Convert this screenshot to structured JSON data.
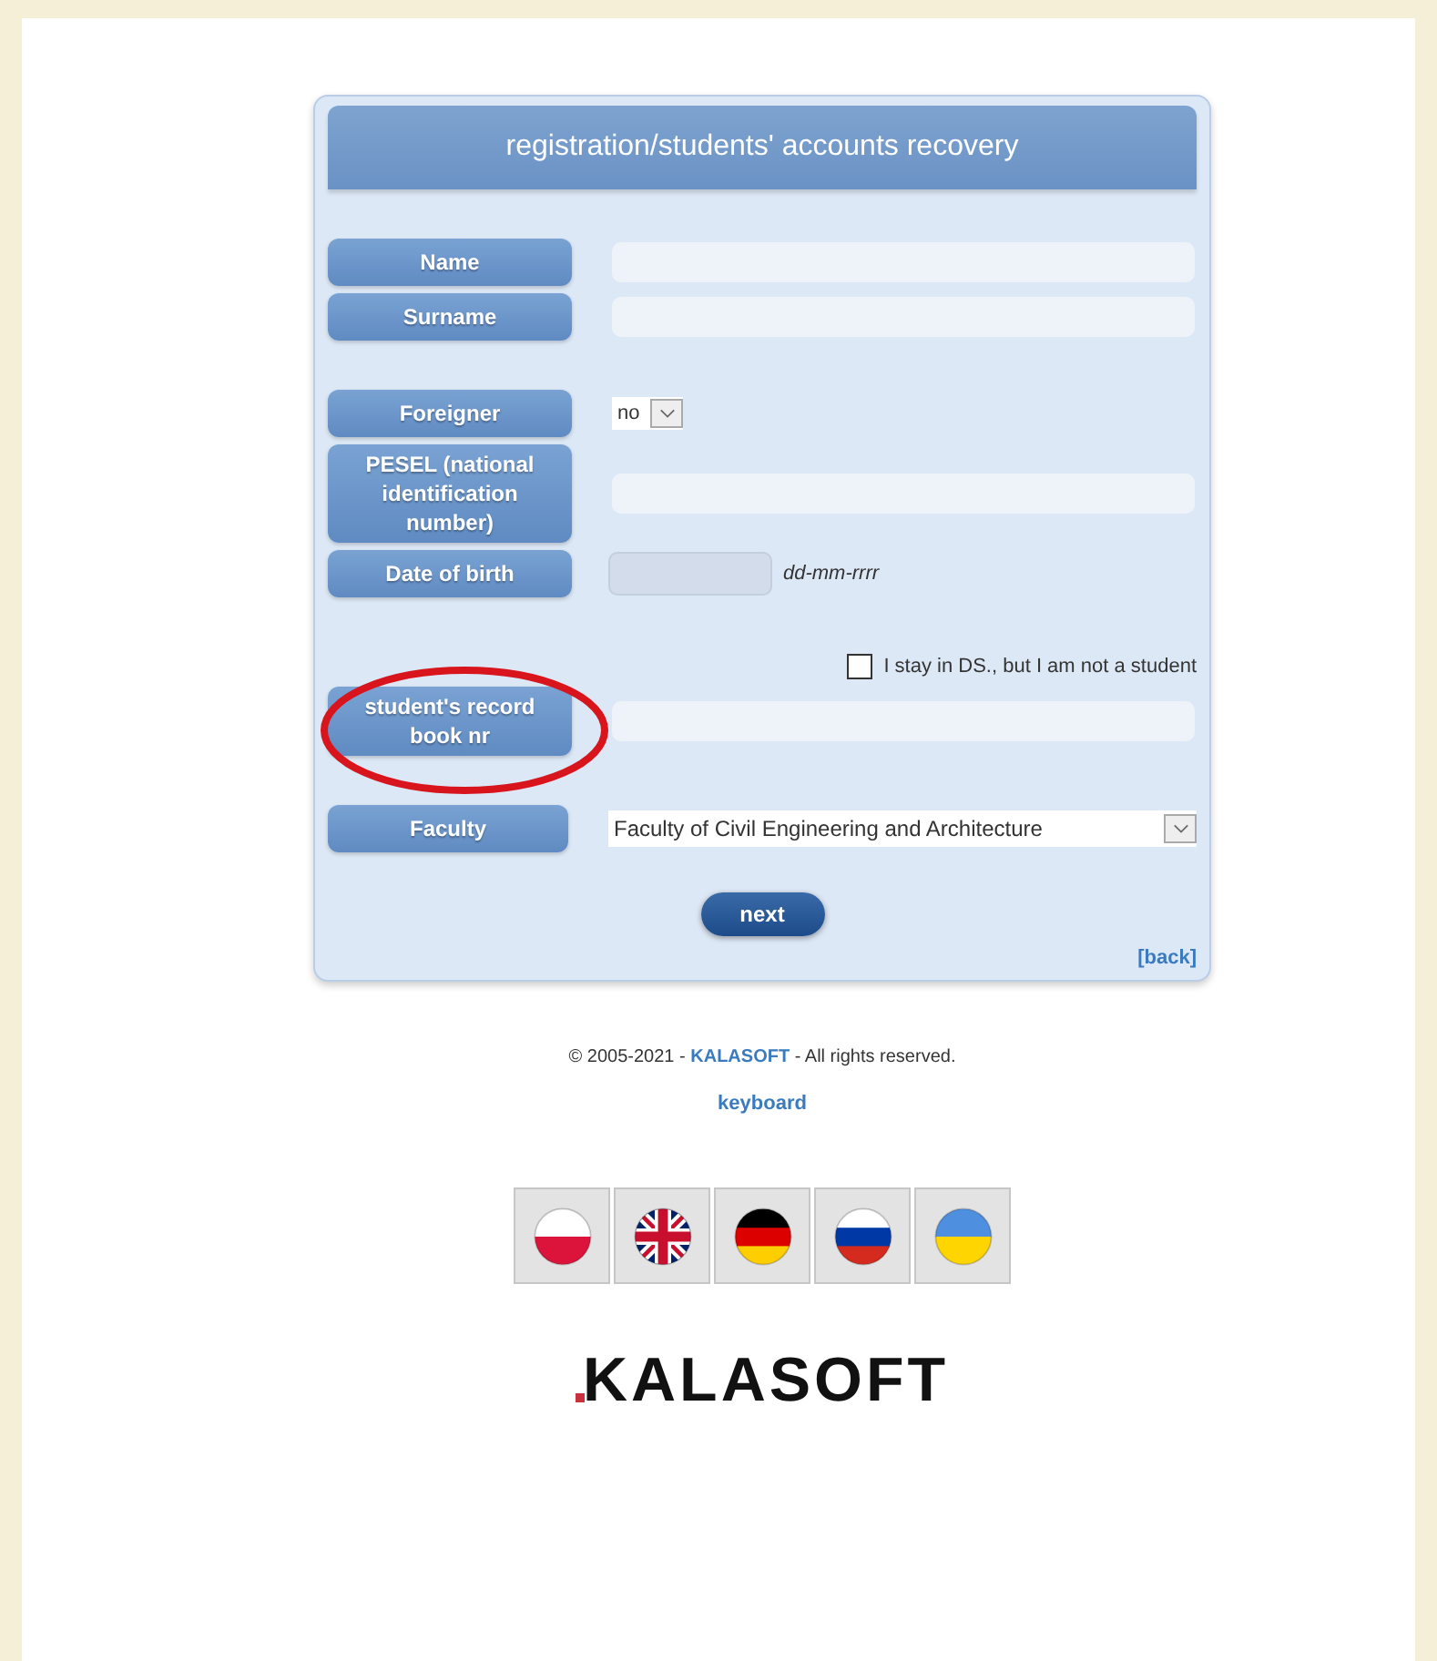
{
  "form": {
    "title": "registration/students' accounts recovery",
    "rows": [
      {
        "kind": "text",
        "label": "Name",
        "value": ""
      },
      {
        "kind": "text",
        "label": "Surname",
        "value": "",
        "gap_after": true
      },
      {
        "kind": "select",
        "label": "Foreigner",
        "value": "no"
      },
      {
        "kind": "text",
        "label": "PESEL (national identification number)",
        "value": ""
      },
      {
        "kind": "date",
        "label": "Date of birth",
        "hint": "dd-mm-rrrr",
        "gap_after": true
      },
      {
        "kind": "checkbox",
        "label": "I stay in DS., but I am not a student",
        "checked": false
      },
      {
        "kind": "text",
        "label": "student's record book nr",
        "value": "",
        "circled": true,
        "gap_after": true
      },
      {
        "kind": "wide_select",
        "label": "Faculty",
        "value": "Faculty of Civil Engineering and Architecture"
      }
    ],
    "submit": "next",
    "back": "[back]"
  },
  "footer": {
    "copyright_before": "© 2005-2021 -",
    "company": "KALASOFT",
    "copyright_after": "- All rights reserved.",
    "keyboard": "keyboard"
  },
  "languages": [
    {
      "kind": "pl"
    },
    {
      "kind": "gb"
    },
    {
      "kind": "de"
    },
    {
      "kind": "ru"
    },
    {
      "kind": "ua"
    }
  ],
  "logo": "KALASOFT"
}
